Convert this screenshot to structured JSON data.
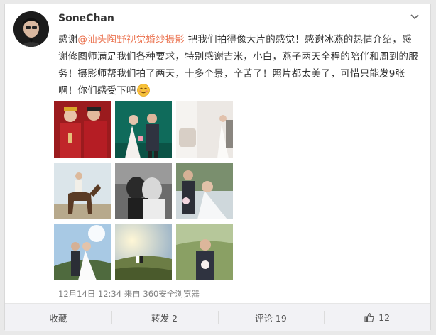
{
  "post": {
    "author": "SoneChan",
    "mention": "@汕头陶野视觉婚纱摄影",
    "text_before": "感谢",
    "text_after": " 把我们拍得像大片的感觉！感谢冰燕的热情介绍，感谢修图师满足我们各种要求，特别感谢吉米，小白，燕子两天全程的陪伴和周到的服务！摄影师帮我们拍了两天，十多个景，辛苦了！照片都太美了，可惜只能发9张啊！你们感受下吧",
    "emoji": "smiley-icon",
    "meta": "12月14日 12:34 来自 360安全浏览器"
  },
  "photos": [
    {
      "name": "photo-chinese-traditional-wedding"
    },
    {
      "name": "photo-couple-green-background"
    },
    {
      "name": "photo-white-room-couple"
    },
    {
      "name": "photo-horse-riding"
    },
    {
      "name": "photo-black-white-kiss"
    },
    {
      "name": "photo-bride-covering-face"
    },
    {
      "name": "photo-hill-sunlight"
    },
    {
      "name": "photo-sunset-field"
    },
    {
      "name": "photo-groom-with-bouquet"
    }
  ],
  "actions": {
    "favorite": "收藏",
    "repost": "转发 2",
    "comment": "评论 19",
    "like": "12"
  },
  "colors": {
    "mention": "#eb7350",
    "action_bar": "#f2f2f5"
  }
}
